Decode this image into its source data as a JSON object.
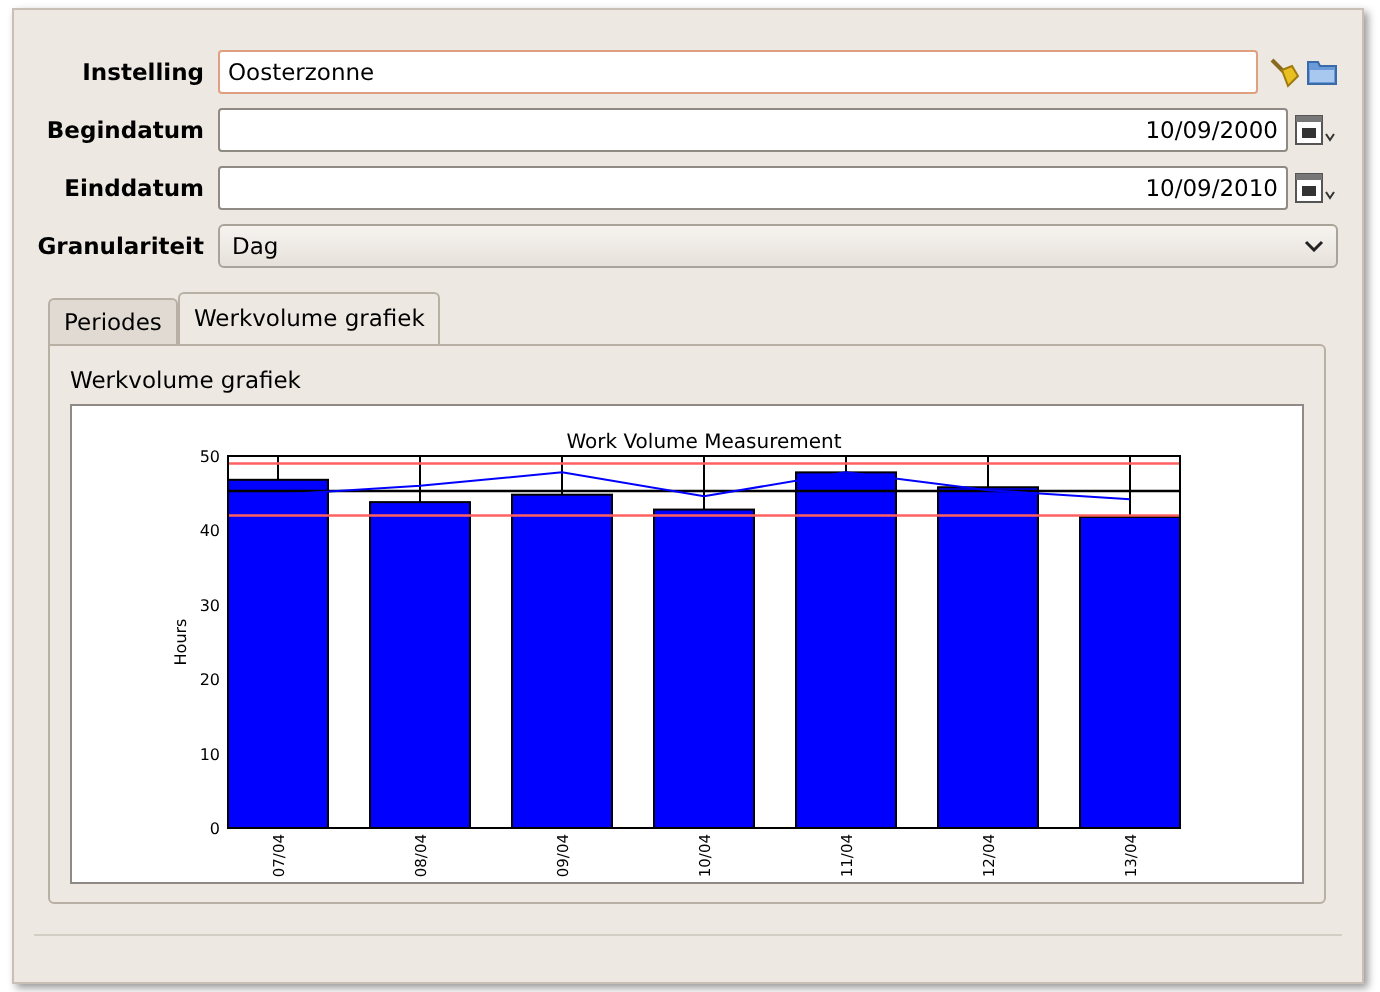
{
  "form": {
    "fields": [
      {
        "label": "Instelling",
        "kind": "text",
        "value": "Oosterzonne"
      },
      {
        "label": "Begindatum",
        "kind": "date",
        "value": "10/09/2000"
      },
      {
        "label": "Einddatum",
        "kind": "date",
        "value": "10/09/2010"
      },
      {
        "label": "Granulariteit",
        "kind": "select",
        "value": "Dag"
      }
    ]
  },
  "tabs": [
    {
      "label": "Periodes",
      "selected": false
    },
    {
      "label": "Werkvolume grafiek",
      "selected": true
    }
  ],
  "panel": {
    "title": "Werkvolume grafiek",
    "chart_data": {
      "type": "bar",
      "title": "Work Volume Measurement",
      "ylabel": "Hours",
      "categories": [
        "07/04",
        "08/04",
        "09/04",
        "10/04",
        "11/04",
        "12/04",
        "13/04"
      ],
      "series": [
        {
          "color": "#0000ff",
          "values": [
            46.8,
            43.8,
            44.8,
            42.8,
            47.8,
            45.8,
            41.8
          ]
        },
        {
          "type": "line",
          "color": "#0000ff",
          "values": [
            44.8,
            46,
            47.8,
            44.6,
            47.8,
            45.4,
            44.2
          ]
        }
      ],
      "ylim": [
        0,
        50
      ],
      "yticks": [
        0,
        10,
        20,
        30,
        40,
        50
      ],
      "ref_lines": [
        {
          "axis": "y",
          "value": 49,
          "color": "#ff6060"
        },
        {
          "axis": "y",
          "value": 42,
          "color": "#ff6060"
        },
        {
          "axis": "y",
          "value": 45.3,
          "color": "#000000"
        }
      ]
    }
  }
}
